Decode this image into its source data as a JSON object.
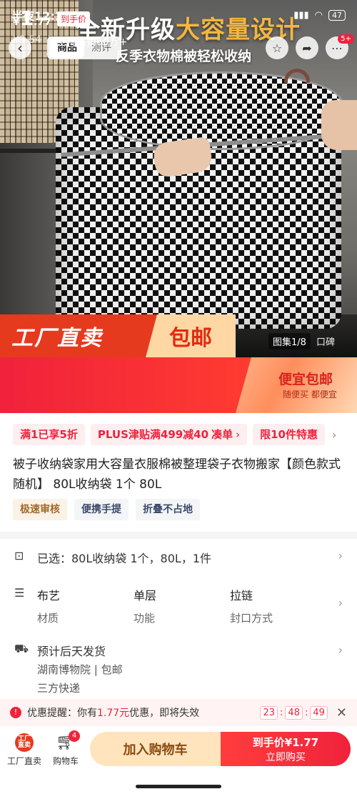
{
  "status": {
    "time": "半夜12:11",
    "battery": "47"
  },
  "nav": {
    "tabs": [
      "商品",
      "测评"
    ],
    "badge": "5+"
  },
  "hero": {
    "title_white": "全新升级",
    "title_accent": "大容量设计",
    "subtitle": "反季衣物棉被轻松收纳",
    "banner_left": "工厂直卖",
    "banner_right": "包邮",
    "gallery": "图集1/8",
    "video": "口碑"
  },
  "price": {
    "symbol": "¥",
    "int": "1",
    "dec": ".77",
    "tag": "到手价",
    "original": "¥3.54",
    "sold": "全网热销60万+",
    "promo_title": "便宜包邮",
    "promo_sub": "随便买 都便宜"
  },
  "coupons": [
    "满1已享5折",
    "PLUS津贴满499减40",
    "凑单",
    "限10件特惠"
  ],
  "product": {
    "title": "被子收纳袋家用大容量衣服棉被整理袋子衣物搬家【颜色款式随机】 80L收纳袋 1个 80L",
    "tags": [
      "极速审核",
      "便携手提",
      "折叠不占地"
    ]
  },
  "selected": "已选：80L收纳袋 1个，80L，1件",
  "specs": [
    {
      "value": "布艺",
      "key": "材质"
    },
    {
      "value": "单层",
      "key": "功能"
    },
    {
      "value": "拉链",
      "key": "封口方式"
    }
  ],
  "shipping": {
    "eta": "预计后天发货",
    "origin": "湖南博物院 | 包邮",
    "courier": "三方快递"
  },
  "reminder": {
    "prefix": "优惠提醒：你有",
    "amount": "1.77元",
    "suffix": "优惠，即将失效",
    "hh": "23",
    "mm": "48",
    "ss": "49"
  },
  "bottom": {
    "factory_logo": "工厂直卖",
    "factory_label": "工厂直卖",
    "cart_label": "购物车",
    "cart_count": "4",
    "add_cart": "加入购物车",
    "buy_top": "到手价¥1.77",
    "buy_sub": "立即购买"
  },
  "colors": {
    "accent": "#f0223c",
    "banner": "#e63a1e",
    "cart_btn": "#ffe4bd"
  }
}
